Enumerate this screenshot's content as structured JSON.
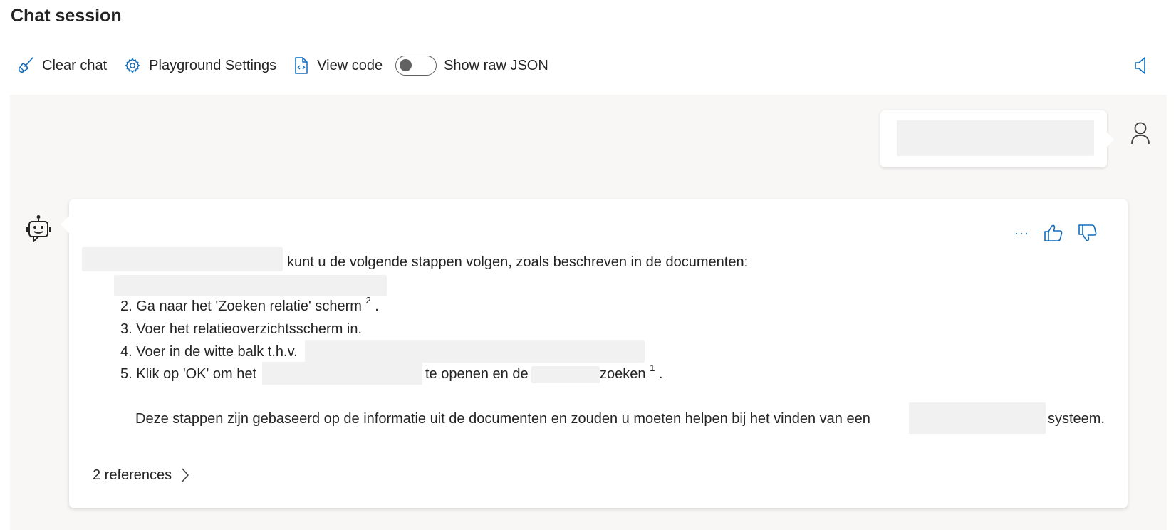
{
  "header": {
    "title": "Chat session"
  },
  "toolbar": {
    "clear_chat": "Clear chat",
    "playground_settings": "Playground Settings",
    "view_code": "View code",
    "show_raw_json": "Show raw JSON",
    "show_raw_json_on": false
  },
  "icons": {
    "clear": "broom-icon",
    "settings": "gear-icon",
    "code": "code-file-icon",
    "speaker": "speaker-icon",
    "user": "person-icon",
    "bot": "bot-icon",
    "more": "more-icon",
    "like": "thumbs-up-icon",
    "dislike": "thumbs-down-icon",
    "chevron": "chevron-right-icon"
  },
  "assistant_message": {
    "intro": "kunt u de volgende stappen volgen, zoals beschreven in de documenten:",
    "steps": [
      {
        "prefix": "2. Ga naar het 'Zoeken relatie' scherm",
        "sup": "2",
        "suffix": "."
      },
      {
        "prefix": "3. Voer het relatieoverzichtsscherm in."
      },
      {
        "prefix": "4. Voer in de witte balk t.h.v."
      },
      {
        "prefix": "5. Klik op 'OK' om het",
        "middle": "te openen en de",
        "end": "zoeken",
        "sup": "1",
        "suffix": "."
      }
    ],
    "closing_prefix": "Deze stappen zijn gebaseerd op de informatie uit de documenten en zouden u moeten helpen bij het vinden van een",
    "closing_suffix": "systeem.",
    "references": "2 references"
  },
  "colors": {
    "accent": "#0f6cbd",
    "chat_background": "#f8f7f6",
    "redaction": "#f1f1f1"
  }
}
